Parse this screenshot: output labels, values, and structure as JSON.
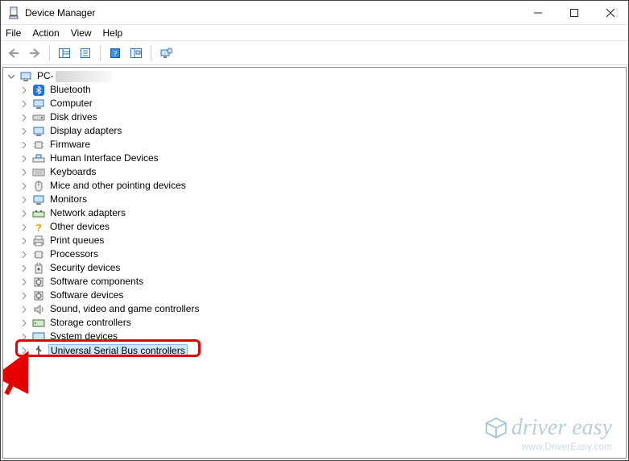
{
  "window": {
    "title": "Device Manager"
  },
  "menubar": {
    "file": "File",
    "action": "Action",
    "view": "View",
    "help": "Help"
  },
  "tree": {
    "root": {
      "label_prefix": "PC-"
    },
    "items": [
      {
        "label": "Bluetooth",
        "icon": "bluetooth-icon"
      },
      {
        "label": "Computer",
        "icon": "computer-icon"
      },
      {
        "label": "Disk drives",
        "icon": "disk-icon"
      },
      {
        "label": "Display adapters",
        "icon": "display-adapter-icon"
      },
      {
        "label": "Firmware",
        "icon": "firmware-icon"
      },
      {
        "label": "Human Interface Devices",
        "icon": "hid-icon"
      },
      {
        "label": "Keyboards",
        "icon": "keyboard-icon"
      },
      {
        "label": "Mice and other pointing devices",
        "icon": "mouse-icon"
      },
      {
        "label": "Monitors",
        "icon": "monitor-icon"
      },
      {
        "label": "Network adapters",
        "icon": "network-icon"
      },
      {
        "label": "Other devices",
        "icon": "other-icon"
      },
      {
        "label": "Print queues",
        "icon": "printer-icon"
      },
      {
        "label": "Processors",
        "icon": "cpu-icon"
      },
      {
        "label": "Security devices",
        "icon": "security-icon"
      },
      {
        "label": "Software components",
        "icon": "software-component-icon"
      },
      {
        "label": "Software devices",
        "icon": "software-device-icon"
      },
      {
        "label": "Sound, video and game controllers",
        "icon": "sound-icon"
      },
      {
        "label": "Storage controllers",
        "icon": "storage-icon"
      },
      {
        "label": "System devices",
        "icon": "system-icon"
      },
      {
        "label": "Universal Serial Bus controllers",
        "icon": "usb-icon",
        "selected": true
      }
    ]
  },
  "watermark": {
    "brand": "driver easy",
    "url": "www.DriverEasy.com"
  }
}
